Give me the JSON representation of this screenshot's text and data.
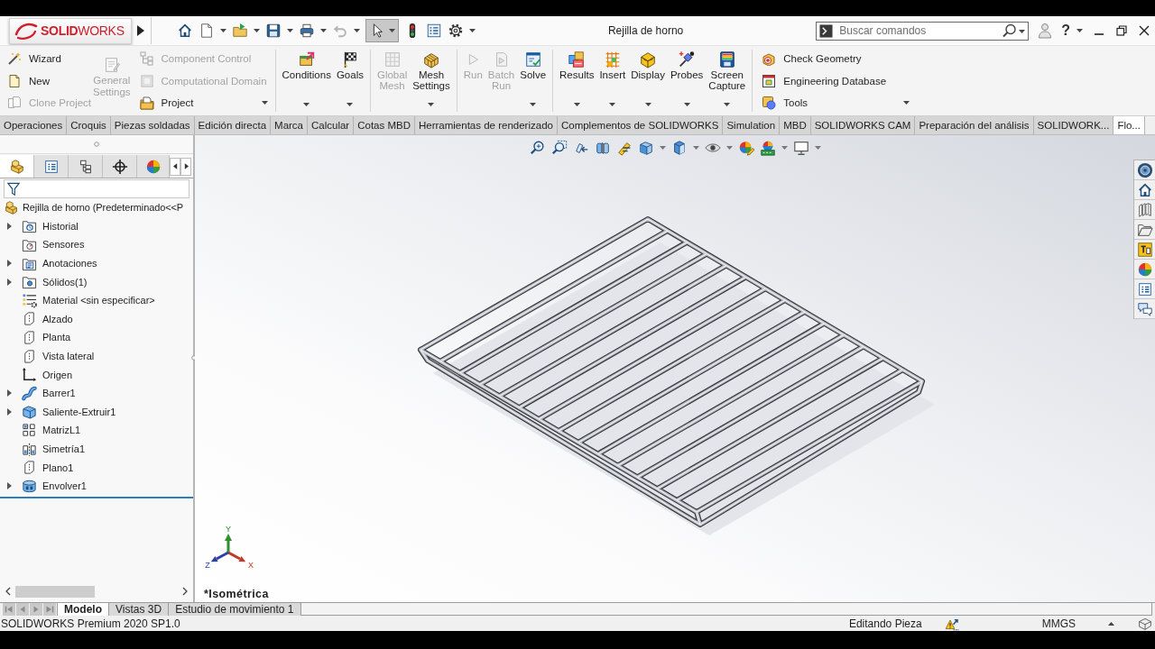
{
  "title_bar": {
    "logo": "**SOLID**WORKS",
    "select_pressed": true,
    "document_title": "Rejilla de horno",
    "search": {
      "placeholder": "Buscar comandos"
    },
    "help": "?"
  },
  "ribbon": {
    "project_items": [
      {
        "label": "Wizard",
        "disabled": false
      },
      {
        "label": "New",
        "disabled": false
      },
      {
        "label": "Clone Project",
        "disabled": true
      }
    ],
    "general_settings": {
      "label": "General Settings",
      "disabled": true
    },
    "setup_items": [
      {
        "label": "Component Control",
        "disabled": true,
        "dropdown": false
      },
      {
        "label": "Computational Domain",
        "disabled": true,
        "dropdown": false
      },
      {
        "label": "Project",
        "disabled": false,
        "dropdown": true
      }
    ],
    "groups": [
      [
        {
          "label": "Conditions",
          "disabled": false,
          "dropdown": true
        },
        {
          "label": "Goals",
          "disabled": false,
          "dropdown": true
        }
      ],
      [
        {
          "label": "Global Mesh",
          "disabled": true,
          "dropdown": false
        },
        {
          "label": "Mesh Settings",
          "disabled": false,
          "dropdown": true
        }
      ],
      [
        {
          "label": "Run",
          "disabled": true,
          "dropdown": false
        },
        {
          "label": "Batch Run",
          "disabled": true,
          "dropdown": false
        },
        {
          "label": "Solve",
          "disabled": false,
          "dropdown": true
        }
      ],
      [
        {
          "label": "Results",
          "disabled": false,
          "dropdown": true
        },
        {
          "label": "Insert",
          "disabled": false,
          "dropdown": true
        },
        {
          "label": "Display",
          "disabled": false,
          "dropdown": true
        },
        {
          "label": "Probes",
          "disabled": false,
          "dropdown": true
        },
        {
          "label": "Screen Capture",
          "disabled": false,
          "dropdown": true
        }
      ]
    ],
    "tool_items": [
      {
        "label": "Check Geometry",
        "dropdown": false
      },
      {
        "label": "Engineering Database",
        "dropdown": false
      },
      {
        "label": "Tools",
        "dropdown": true
      }
    ]
  },
  "command_tabs": [
    {
      "label": "Operaciones",
      "selected": false
    },
    {
      "label": "Croquis",
      "selected": false
    },
    {
      "label": "Piezas soldadas",
      "selected": false
    },
    {
      "label": "Edición directa",
      "selected": false
    },
    {
      "label": "Marca",
      "selected": false
    },
    {
      "label": "Calcular",
      "selected": false
    },
    {
      "label": "Cotas MBD",
      "selected": false
    },
    {
      "label": "Herramientas de renderizado",
      "selected": false
    },
    {
      "label": "Complementos de SOLIDWORKS",
      "selected": false
    },
    {
      "label": "Simulation",
      "selected": false
    },
    {
      "label": "MBD",
      "selected": false
    },
    {
      "label": "SOLIDWORKS CAM",
      "selected": false
    },
    {
      "label": "Preparación del análisis",
      "selected": false
    },
    {
      "label": "SOLIDWORK...",
      "selected": false
    },
    {
      "label": "Flo...",
      "selected": true
    }
  ],
  "feature_manager": {
    "panel_tabs": [
      {
        "selected": true
      },
      {
        "selected": false
      },
      {
        "selected": false
      },
      {
        "selected": false
      },
      {
        "selected": false
      }
    ]
  },
  "tree": {
    "label": "Rejilla de horno (Predeterminado<<P",
    "kind": "part",
    "children": [
      {
        "label": "Historial",
        "kind": "history",
        "expandable": true
      },
      {
        "label": "Sensores",
        "kind": "sensors",
        "expandable": false
      },
      {
        "label": "Anotaciones",
        "kind": "annotations",
        "expandable": true
      },
      {
        "label": "Sólidos(1)",
        "kind": "bodies",
        "expandable": true
      },
      {
        "label": "Material <sin especificar>",
        "kind": "material",
        "expandable": false
      },
      {
        "label": "Alzado",
        "kind": "plane",
        "expandable": false
      },
      {
        "label": "Planta",
        "kind": "plane",
        "expandable": false
      },
      {
        "label": "Vista lateral",
        "kind": "plane",
        "expandable": false
      },
      {
        "label": "Origen",
        "kind": "origin",
        "expandable": false
      },
      {
        "label": "Barrer1",
        "kind": "sweep",
        "expandable": true
      },
      {
        "label": "Saliente-Extruir1",
        "kind": "extrude",
        "expandable": true
      },
      {
        "label": "MatrizL1",
        "kind": "pattern",
        "expandable": false
      },
      {
        "label": "Simetría1",
        "kind": "mirror",
        "expandable": false
      },
      {
        "label": "Plano1",
        "kind": "plane",
        "expandable": false
      },
      {
        "label": "Envolver1",
        "kind": "wrap",
        "expandable": true
      }
    ]
  },
  "viewport": {
    "view_name": "*Isométrica",
    "triad": {
      "x": "X",
      "y": "Y",
      "z": "Z"
    }
  },
  "bottom_tabs": [
    {
      "label": "Modelo",
      "selected": true
    },
    {
      "label": "Vistas 3D",
      "selected": false
    },
    {
      "label": "Estudio de movimiento 1",
      "selected": false
    }
  ],
  "status_bar": {
    "product": "SOLIDWORKS Premium 2020 SP1.0",
    "mode": "Editando Pieza",
    "units": "MMGS"
  }
}
